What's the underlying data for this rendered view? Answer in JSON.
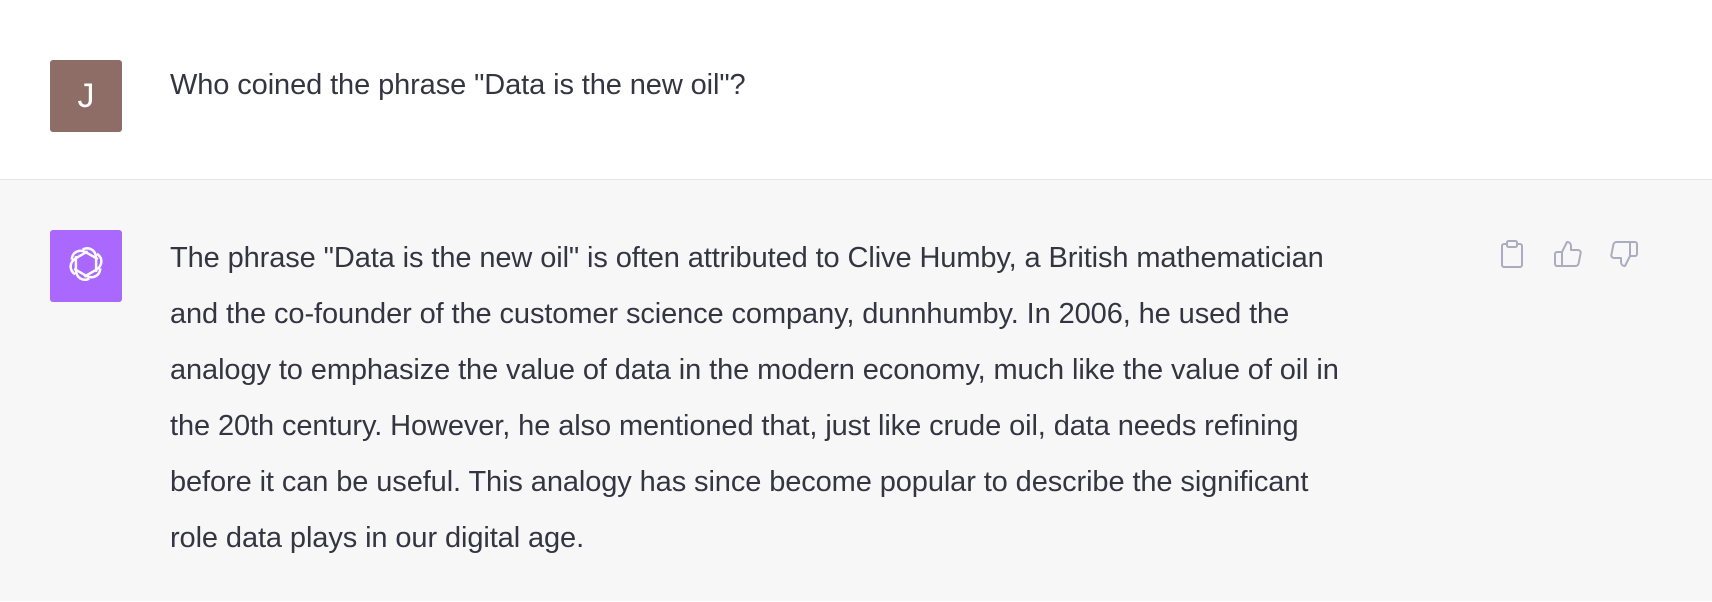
{
  "conversation": {
    "user": {
      "avatar_initial": "J",
      "avatar_color": "#8e6d66",
      "message": "Who coined the phrase \"Data is the new oil\"?"
    },
    "assistant": {
      "avatar_icon": "openai-logo-icon",
      "avatar_color": "#ab68ff",
      "answer_lines": [
        "The phrase \"Data is the new oil\" is often attributed to Clive Humby, a British mathematician",
        "and the co-founder of the customer science company, dunnhumby. In 2006, he used the",
        "analogy to emphasize the value of data in the modern economy, much like the value of oil in",
        "the 20th century. However, he also mentioned that, just like crude oil, data needs refining",
        "before it can be useful. This analogy has since become popular to describe the significant",
        "role data plays in our digital age."
      ],
      "actions": [
        {
          "icon": "clipboard-icon"
        },
        {
          "icon": "thumbs-up-icon"
        },
        {
          "icon": "thumbs-down-icon"
        }
      ]
    }
  },
  "colors": {
    "user_background": "#ffffff",
    "assistant_background": "#f7f7f8",
    "text": "#343541",
    "icon": "#acacbe"
  }
}
